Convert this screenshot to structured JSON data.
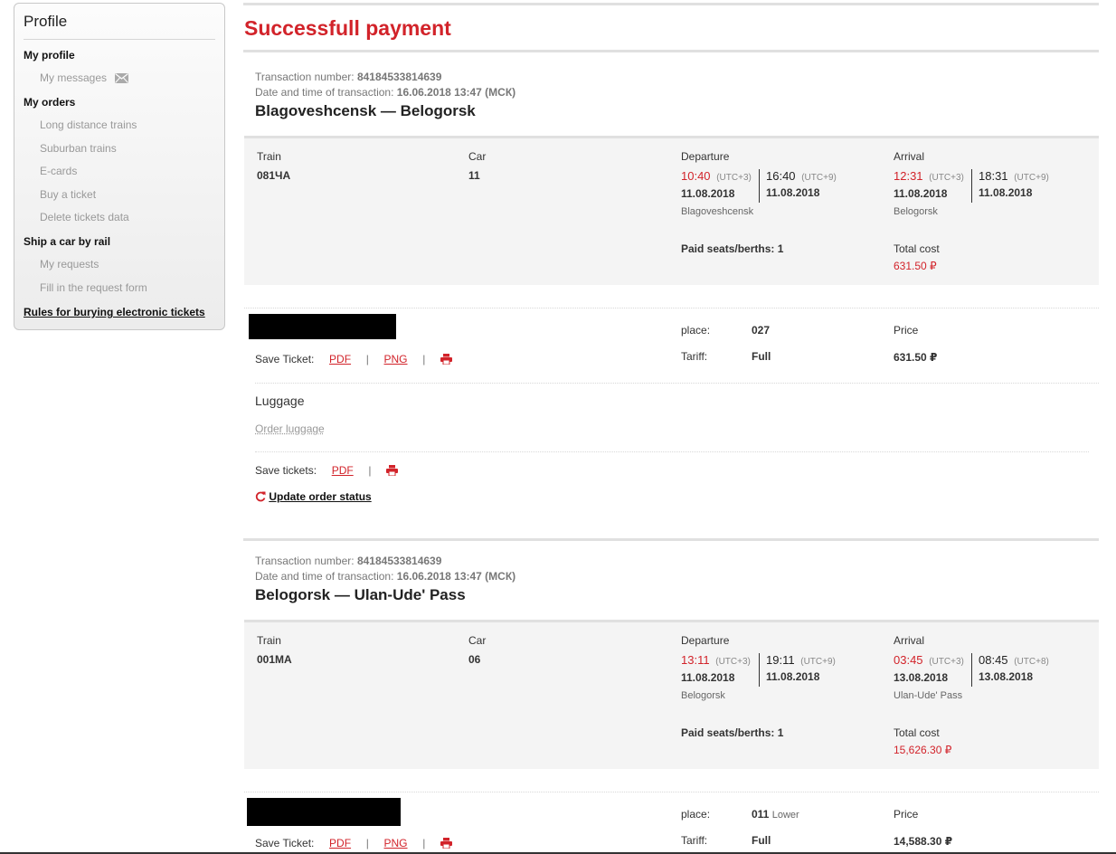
{
  "sidebar": {
    "title": "Profile",
    "my_profile": "My profile",
    "my_messages": "My messages",
    "my_orders": "My orders",
    "long_distance": "Long distance trains",
    "suburban": "Suburban trains",
    "ecards": "E-cards",
    "buy_ticket": "Buy a ticket",
    "delete_data": "Delete tickets data",
    "ship_car": "Ship a car by rail",
    "my_requests": "My requests",
    "fill_form": "Fill in the request form",
    "rules": "Rules for burying electronic tickets"
  },
  "page_title": "Successfull payment",
  "labels": {
    "tx_number": "Transaction number:",
    "tx_datetime": "Date and time of transaction:",
    "train": "Train",
    "car": "Car",
    "departure": "Departure",
    "arrival": "Arrival",
    "paid_seats": "Paid seats/berths: 1",
    "total_cost": "Total cost",
    "place": "place:",
    "tariff": "Tariff:",
    "price": "Price",
    "save_ticket": "Save Ticket:",
    "pdf": "PDF",
    "png": "PNG",
    "pipe": "|",
    "luggage": "Luggage",
    "order_luggage": "Order luggage",
    "save_tickets": "Save tickets:",
    "update_status": "Update order status"
  },
  "orders": [
    {
      "tx_number": "84184533814639",
      "tx_datetime": "16.06.2018 13:47 (МСК)",
      "route": "Blagoveshcensk — Belogorsk",
      "train": "081ЧА",
      "car": "11",
      "dep_time_local": "10:40",
      "dep_tz_local": "(UTC+3)",
      "dep_date_local": "11.08.2018",
      "dep_time_2": "16:40",
      "dep_tz_2": "(UTC+9)",
      "dep_date_2": "11.08.2018",
      "dep_city": "Blagoveshcensk",
      "arr_time_local": "12:31",
      "arr_tz_local": "(UTC+3)",
      "arr_date_local": "11.08.2018",
      "arr_time_2": "18:31",
      "arr_tz_2": "(UTC+9)",
      "arr_date_2": "11.08.2018",
      "arr_city": "Belogorsk",
      "total_cost": "631.50 ₽",
      "place": "027",
      "place_note": "",
      "tariff": "Full",
      "price": "631.50 ₽"
    },
    {
      "tx_number": "84184533814639",
      "tx_datetime": "16.06.2018 13:47 (МСК)",
      "route": "Belogorsk — Ulan-Ude' Pass",
      "train": "001МА",
      "car": "06",
      "dep_time_local": "13:11",
      "dep_tz_local": "(UTC+3)",
      "dep_date_local": "11.08.2018",
      "dep_time_2": "19:11",
      "dep_tz_2": "(UTC+9)",
      "dep_date_2": "11.08.2018",
      "dep_city": "Belogorsk",
      "arr_time_local": "03:45",
      "arr_tz_local": "(UTC+3)",
      "arr_date_local": "13.08.2018",
      "arr_time_2": "08:45",
      "arr_tz_2": "(UTC+8)",
      "arr_date_2": "13.08.2018",
      "arr_city": "Ulan-Ude' Pass",
      "total_cost": "15,626.30 ₽",
      "place": "011",
      "place_note": "Lower",
      "tariff": "Full",
      "price": "14,588.30 ₽"
    }
  ],
  "colors": {
    "accent": "#d2232a",
    "panel": "#f4f4f4",
    "muted": "#999999"
  }
}
